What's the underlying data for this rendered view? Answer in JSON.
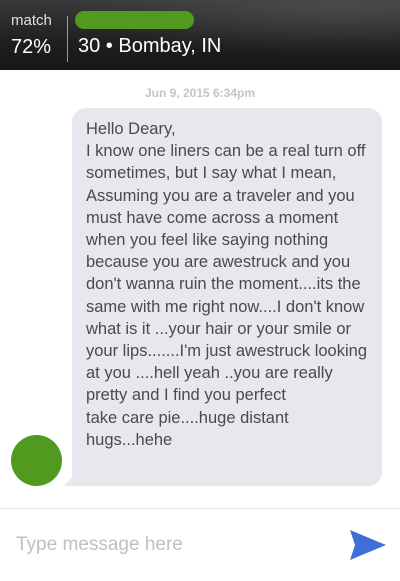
{
  "header": {
    "match_label": "match",
    "match_value": "72%",
    "profile_info": "30 • Bombay, IN",
    "name_pill_color": "#4f9a1f"
  },
  "conversation": {
    "timestamp": "Jun 9, 2015 6:34pm",
    "messages": [
      {
        "sender_avatar_color": "#4f9a1f",
        "text": "Hello Deary,\nI know one liners can be a real turn off sometimes, but I say what I mean, Assuming you are a traveler and you must have come across a moment when you feel like saying nothing because you are awestruck and you don't wanna ruin the moment....its the same with me right now....I don't know what is it ...your hair or your smile or your lips.......I'm just awestruck looking at you ....hell yeah ..you are really pretty and I find you perfect\ntake care pie....huge distant hugs...hehe"
      }
    ]
  },
  "composer": {
    "placeholder": "Type message here",
    "value": "",
    "send_icon": "send-icon",
    "send_color": "#3d6fd6"
  }
}
